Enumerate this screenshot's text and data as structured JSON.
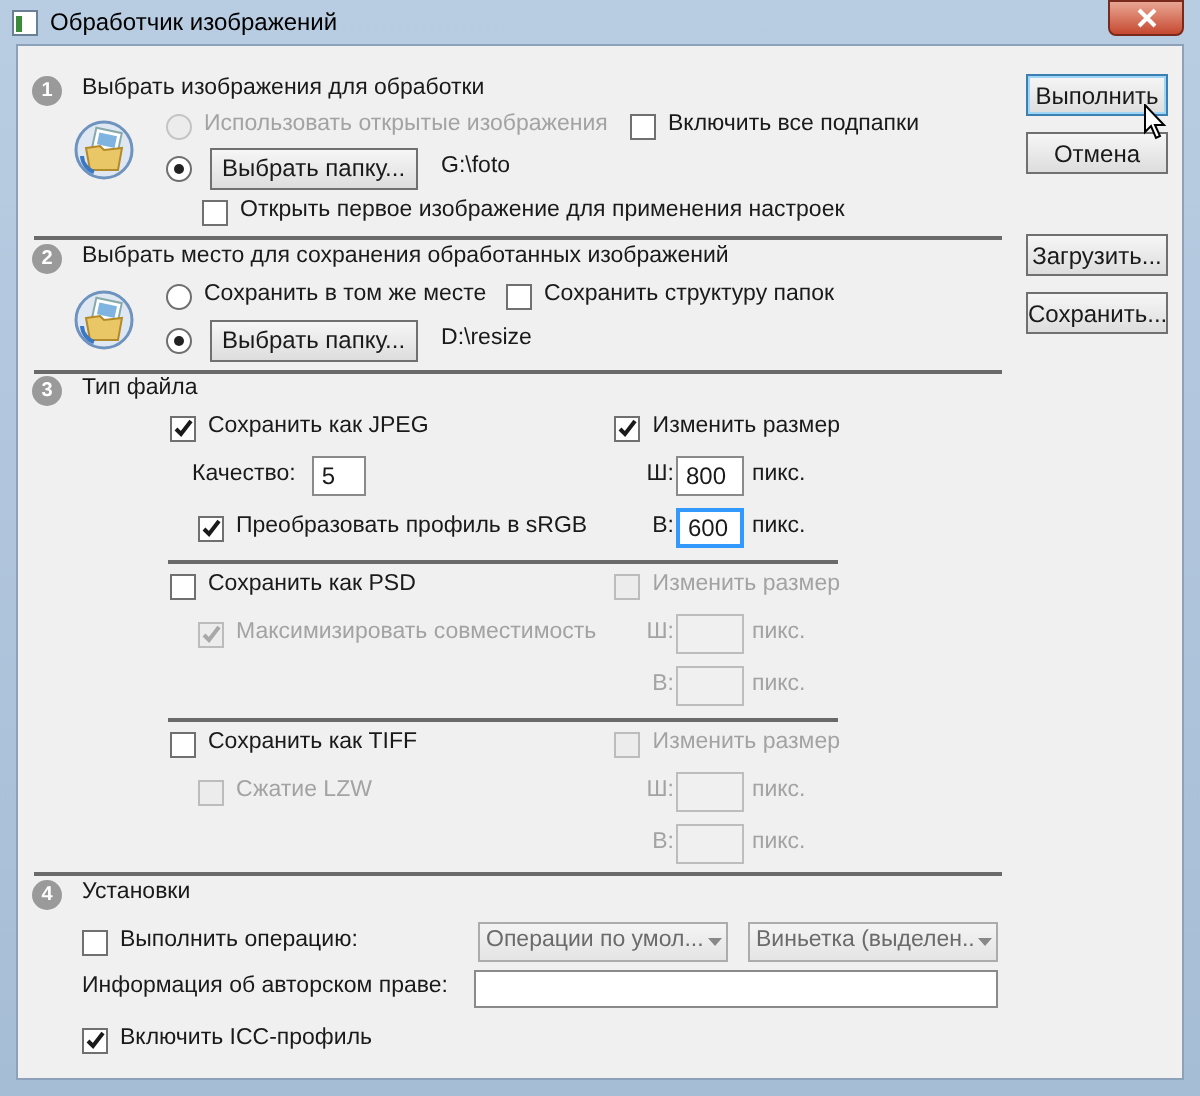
{
  "window": {
    "title": "Обработчик изображений"
  },
  "source": {
    "number": "1",
    "title": "Выбрать изображения для обработки",
    "use_open": {
      "label": "Использовать открытые изображения",
      "selected": false,
      "disabled": true
    },
    "include_subfolders": {
      "label": "Включить все подпапки",
      "checked": false
    },
    "choose_folder": {
      "label": "Выбрать папку...",
      "selected": true
    },
    "folder_path": "G:\\foto",
    "open_first": {
      "label": "Открыть первое изображение для применения настроек",
      "checked": false
    }
  },
  "destination": {
    "number": "2",
    "title": "Выбрать место для сохранения обработанных изображений",
    "same_place": {
      "label": "Сохранить в том же месте",
      "selected": false
    },
    "keep_structure": {
      "label": "Сохранить структуру папок",
      "checked": false
    },
    "choose_folder": {
      "label": "Выбрать папку...",
      "selected": true
    },
    "folder_path": "D:\\resize"
  },
  "file_type": {
    "number": "3",
    "title": "Тип файла",
    "formats": [
      {
        "label": "Сохранить как JPEG",
        "checked": true,
        "resize": {
          "label": "Изменить размер",
          "checked": true,
          "disabled": false
        },
        "width": {
          "label": "Ш:",
          "value": "800",
          "unit": "пикс.",
          "disabled": false,
          "focused": false
        },
        "height": {
          "label": "В:",
          "value": "600",
          "unit": "пикс.",
          "disabled": false,
          "focused": true
        },
        "options": [
          {
            "kind": "field",
            "label": "Качество:",
            "value": "5"
          },
          {
            "kind": "checkbox",
            "label": "Преобразовать профиль в sRGB",
            "checked": true,
            "disabled": false
          }
        ]
      },
      {
        "label": "Сохранить как PSD",
        "checked": false,
        "resize": {
          "label": "Изменить размер",
          "checked": false,
          "disabled": true
        },
        "width": {
          "label": "Ш:",
          "unit": "пикс.",
          "disabled": true,
          "focused": false
        },
        "height": {
          "label": "В:",
          "unit": "пикс.",
          "disabled": true,
          "focused": false
        },
        "options": [
          {
            "kind": "checkbox",
            "label": "Максимизировать совместимость",
            "checked": true,
            "disabled": true
          }
        ]
      },
      {
        "label": "Сохранить как TIFF",
        "checked": false,
        "resize": {
          "label": "Изменить размер",
          "checked": false,
          "disabled": true
        },
        "width": {
          "label": "Ш:",
          "unit": "пикс.",
          "disabled": true,
          "focused": false
        },
        "height": {
          "label": "В:",
          "unit": "пикс.",
          "disabled": true,
          "focused": false
        },
        "options": [
          {
            "kind": "checkbox",
            "label": "Сжатие LZW",
            "checked": false,
            "disabled": true
          }
        ]
      }
    ]
  },
  "preferences": {
    "number": "4",
    "title": "Установки",
    "run_action": {
      "label": "Выполнить операцию:",
      "checked": false
    },
    "action_sets": [
      {
        "value": "Операции по умол...",
        "disabled": true
      },
      {
        "value": "Виньетка (выделен..",
        "disabled": true
      }
    ],
    "copyright": {
      "label": "Информация об авторском праве:"
    },
    "include_icc": {
      "label": "Включить ICC-профиль",
      "checked": true
    }
  },
  "buttons": [
    {
      "label": "Выполнить",
      "default": true
    },
    {
      "label": "Отмена",
      "default": false
    },
    {
      "label": "Загрузить...",
      "default": false
    },
    {
      "label": "Сохранить...",
      "default": false
    }
  ]
}
